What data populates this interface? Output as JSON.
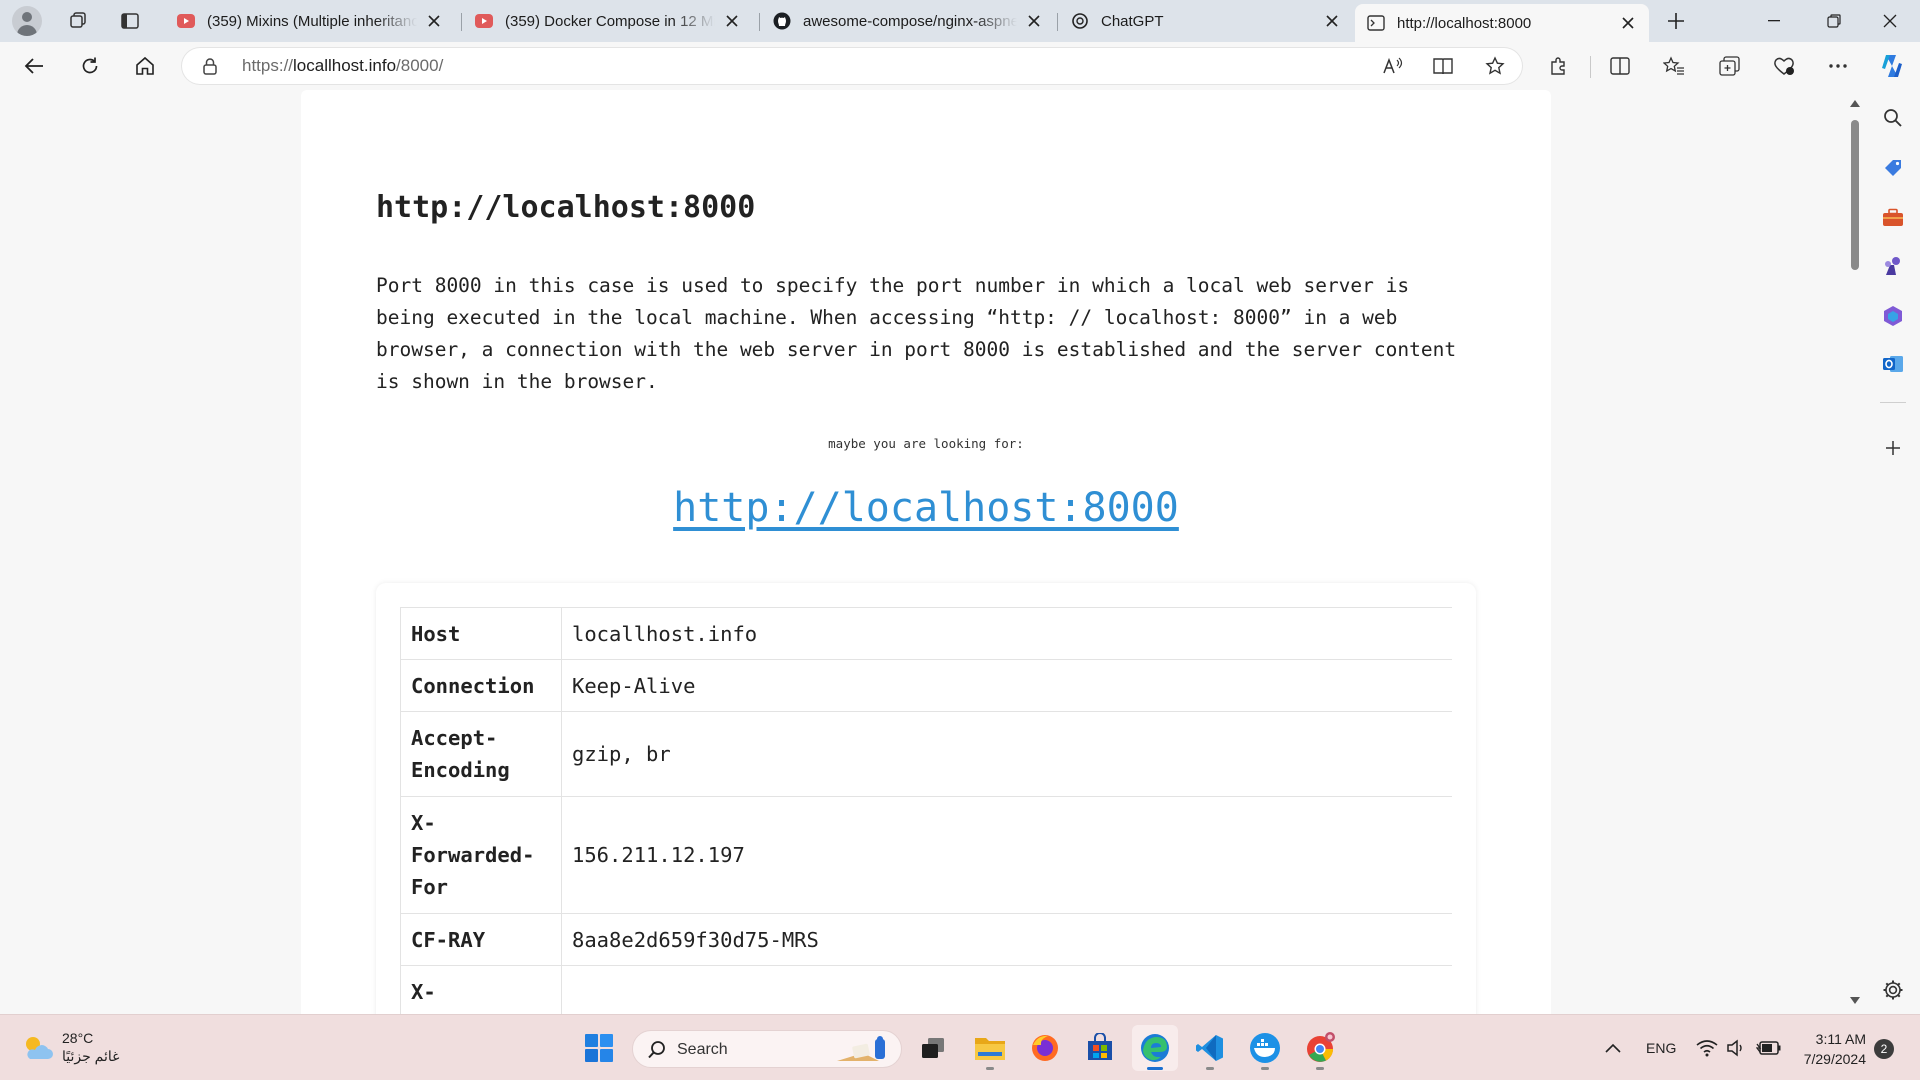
{
  "browser": {
    "tabs": [
      {
        "title": "(359) Mixins (Multiple inheritance",
        "icon": "youtube-icon",
        "active": false
      },
      {
        "title": "(359) Docker Compose in 12 Min",
        "icon": "youtube-icon",
        "active": false
      },
      {
        "title": "awesome-compose/nginx-aspnet",
        "icon": "github-icon",
        "active": false
      },
      {
        "title": "ChatGPT",
        "icon": "chatgpt-icon",
        "active": false
      },
      {
        "title": "http://localhost:8000",
        "icon": "terminal-page-icon",
        "active": true
      }
    ],
    "address": {
      "url_prefix": "https://",
      "url_host": "locallhost.info",
      "url_path": "/8000/"
    }
  },
  "page": {
    "heading": "http://localhost:8000",
    "description": "Port 8000 in this case is used to specify the port number in which a local web server is being executed in the local machine. When accessing “http: // localhost: 8000” in a web browser, a connection with the web server in port 8000 is established and the server content is shown in the browser.",
    "looking_for": "maybe you are looking for:",
    "suggested_link": "http://localhost:8000",
    "headers": [
      {
        "key": "Host",
        "value": "locallhost.info"
      },
      {
        "key": "Connection",
        "value": "Keep-Alive"
      },
      {
        "key": "Accept-Encoding",
        "value": "gzip, br"
      },
      {
        "key": "X-Forwarded-For",
        "value": "156.211.12.197"
      },
      {
        "key": "CF-RAY",
        "value": "8aa8e2d659f30d75-MRS"
      },
      {
        "key": "X-",
        "value": ""
      }
    ]
  },
  "taskbar": {
    "weather_temp": "28°C",
    "weather_desc": "غائم جزئيًا",
    "search_label": "Search",
    "language": "ENG",
    "time": "3:11 AM",
    "date": "7/29/2024",
    "notification_count": "2"
  },
  "colors": {
    "link": "#2f8fd4",
    "accent": "#1a6fd0",
    "taskbar": "#f0dede"
  }
}
